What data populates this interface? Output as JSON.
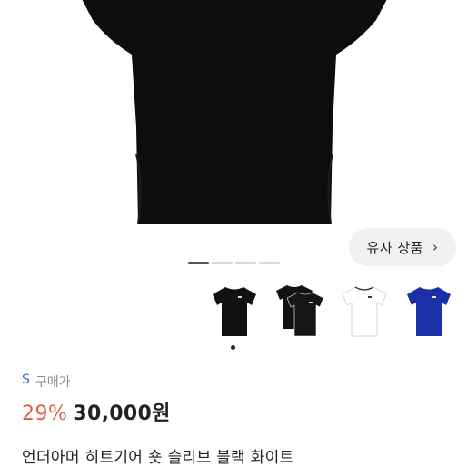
{
  "product": {
    "title": "언더아머 히트기어 숏 슬리브 블랙 화이트",
    "size": "S",
    "purchase_label": "구매가",
    "discount": "29%",
    "price": "30,000원"
  },
  "similar_button": {
    "label": "유사 상품",
    "icon": "chevron-right-icon",
    "chevron": "›"
  },
  "gallery": {
    "page_count": 4,
    "active_index": 0
  },
  "thumbnails": [
    {
      "name": "black-shirt",
      "color": "#111111",
      "selected": true
    },
    {
      "name": "black-shirt-pair",
      "color": "#111111",
      "selected": false
    },
    {
      "name": "white-shirt",
      "color": "#ffffff",
      "selected": false
    },
    {
      "name": "blue-shirt",
      "color": "#1b2fa6",
      "selected": false
    }
  ],
  "colors": {
    "discount": "#e0614a",
    "size": "#3d6ae0",
    "hero_shirt": "#0d0d0d"
  }
}
